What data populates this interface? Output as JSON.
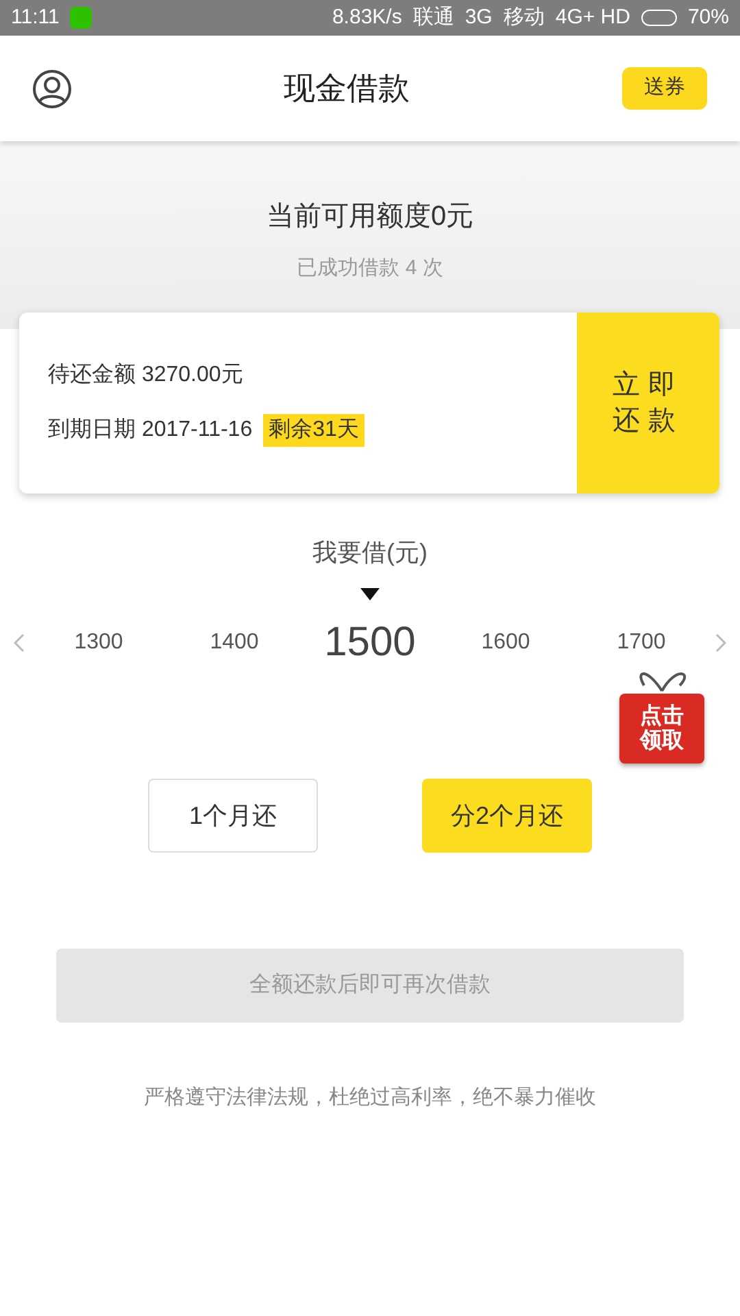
{
  "status_bar": {
    "time": "11:11",
    "speed": "8.83K/s",
    "carrier_1": "联通",
    "network_1": "3G",
    "carrier_2": "移动",
    "network_2": "4G+ HD",
    "battery": "70%"
  },
  "header": {
    "title": "现金借款",
    "coupon_button": "送券"
  },
  "quota": {
    "title": "当前可用额度0元",
    "subtitle": "已成功借款 4 次"
  },
  "loan_card": {
    "amount_due": "待还金额 3270.00元",
    "due_date": "到期日期 2017-11-16",
    "remaining_badge": "剩余31天",
    "repay_button": "立即还款"
  },
  "picker": {
    "label": "我要借(元)",
    "amounts": [
      {
        "value": "1300",
        "selected": false
      },
      {
        "value": "1400",
        "selected": false
      },
      {
        "value": "1500",
        "selected": true
      },
      {
        "value": "1600",
        "selected": false
      },
      {
        "value": "1700",
        "selected": false
      }
    ]
  },
  "gift": {
    "label": "点击领取"
  },
  "plans": [
    {
      "label": "1个月还",
      "selected": false
    },
    {
      "label": "分2个月还",
      "selected": true
    }
  ],
  "submit": {
    "label": "全额还款后即可再次借款",
    "disabled": true
  },
  "footer": "严格遵守法律法规，杜绝过高利率，绝不暴力催收"
}
